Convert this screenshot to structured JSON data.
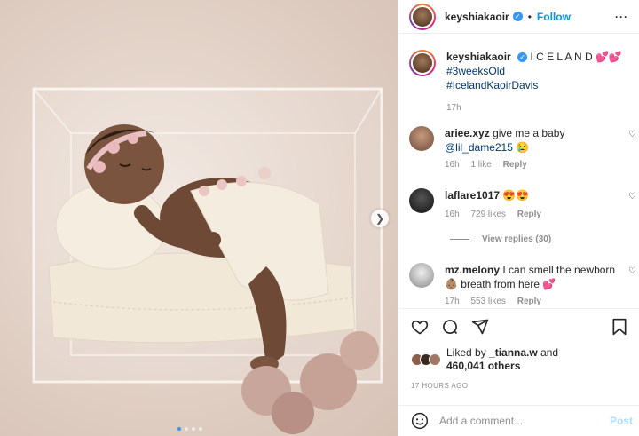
{
  "post": {
    "username": "keyshiakaoir",
    "follow_label": "Follow",
    "separator": "•",
    "more_label": "···",
    "next_icon": "chevron-right-icon",
    "caption": {
      "line1": "I C E L A N D 💕💕",
      "tags": [
        "#3weeksOld",
        "#IcelandKaoirDavis"
      ],
      "time": "17h"
    }
  },
  "comments": [
    {
      "user": "ariee.xyz",
      "text": "give me a baby",
      "mention": "@lil_dame215",
      "tail": " 😢",
      "time": "16h",
      "likes": "1 like",
      "reply": "Reply"
    },
    {
      "user": "laflare1017",
      "text": "😍😍",
      "mention": "",
      "tail": "",
      "time": "16h",
      "likes": "729 likes",
      "reply": "Reply"
    },
    {
      "user": "mz.melony",
      "text": "I can smell the newborn 👶🏽 breath from here 💕",
      "mention": "",
      "tail": "",
      "time": "17h",
      "likes": "553 likes",
      "reply": "Reply"
    }
  ],
  "view_replies": "View replies (30)",
  "likes": {
    "prefix": "Liked by",
    "user": "_tianna.w",
    "and": "and",
    "count": "460,041 others"
  },
  "posted_ago": "17 HOURS AGO",
  "add_comment": {
    "placeholder": "Add a comment...",
    "post_label": "Post"
  },
  "icons": [
    "heart-icon",
    "comment-icon",
    "share-icon",
    "bookmark-icon",
    "emoji-icon"
  ],
  "colors": {
    "accent": "#0095f6",
    "muted": "#8e8e8e",
    "link": "#00376b"
  }
}
